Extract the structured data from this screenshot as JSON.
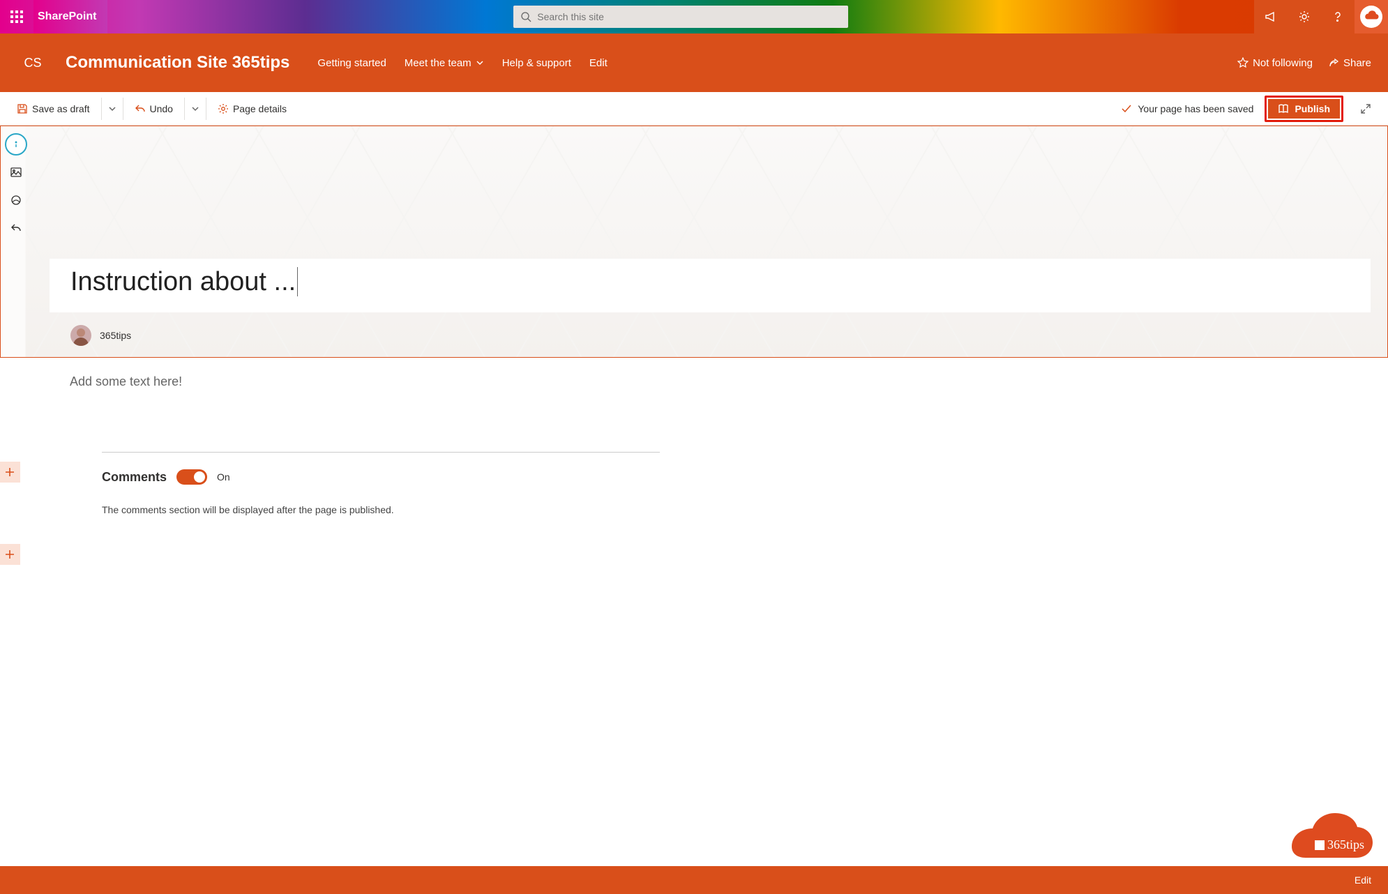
{
  "suite": {
    "brand": "SharePoint",
    "search_placeholder": "Search this site"
  },
  "site": {
    "logo_text": "CS",
    "title": "Communication Site 365tips",
    "nav": {
      "getting_started": "Getting started",
      "meet_team": "Meet the team",
      "help": "Help & support",
      "edit": "Edit"
    },
    "follow": "Not following",
    "share": "Share"
  },
  "commands": {
    "save_draft": "Save as draft",
    "undo": "Undo",
    "page_details": "Page details",
    "status": "Your page has been saved",
    "publish": "Publish"
  },
  "page": {
    "title": "Instruction about ...",
    "author": "365tips",
    "body_placeholder": "Add some text here!",
    "comments_heading": "Comments",
    "comments_toggle_label": "On",
    "comments_note": "The comments section will be displayed after the page is published."
  },
  "badge": {
    "text": "365tips"
  },
  "footer": {
    "edit": "Edit"
  },
  "colors": {
    "accent": "#d94f1a",
    "highlight_border": "#e31b0c"
  }
}
